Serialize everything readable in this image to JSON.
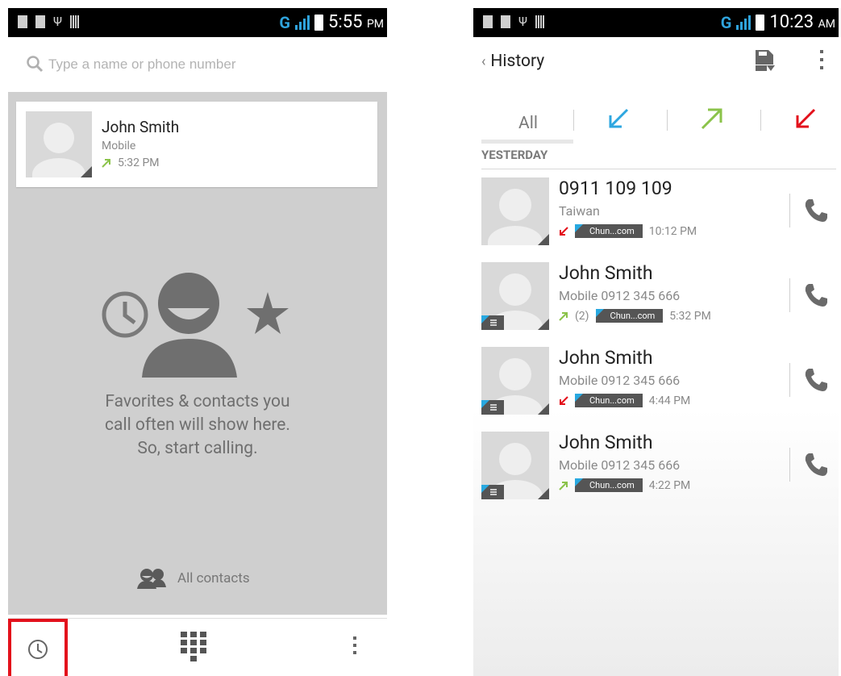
{
  "left_screen": {
    "statusbar": {
      "network": "G",
      "time": "5:55",
      "ampm": "PM"
    },
    "search": {
      "placeholder": "Type a name or phone number"
    },
    "recent_card": {
      "name": "John Smith",
      "type": "Mobile",
      "time": "5:32 PM"
    },
    "empty_state": {
      "line1": "Favorites & contacts you",
      "line2": "call often will show here.",
      "line3": "So, start calling."
    },
    "all_contacts_label": "All contacts"
  },
  "right_screen": {
    "statusbar": {
      "network": "G",
      "time": "10:23",
      "ampm": "AM"
    },
    "title": "History",
    "tabs": {
      "all": "All"
    },
    "section": "YESTERDAY",
    "calls": [
      {
        "name": "0911 109 109",
        "sub": "Taiwan",
        "direction": "missed",
        "count": "",
        "sim": "Chun...com",
        "time": "10:12 PM",
        "sim_badge": false
      },
      {
        "name": "John Smith",
        "sub": "Mobile 0912 345 666",
        "direction": "outgoing",
        "count": "(2)",
        "sim": "Chun...com",
        "time": "5:32 PM",
        "sim_badge": true
      },
      {
        "name": "John Smith",
        "sub": "Mobile 0912 345 666",
        "direction": "missed",
        "count": "",
        "sim": "Chun...com",
        "time": "4:44 PM",
        "sim_badge": true
      },
      {
        "name": "John Smith",
        "sub": "Mobile 0912 345 666",
        "direction": "outgoing",
        "count": "",
        "sim": "Chun...com",
        "time": "4:22 PM",
        "sim_badge": true
      }
    ]
  },
  "colors": {
    "incoming": "#2ea7e0",
    "outgoing": "#8bc34a",
    "missed": "#e3101b",
    "highlight": "#e3101b",
    "network": "#2fa3dc"
  }
}
